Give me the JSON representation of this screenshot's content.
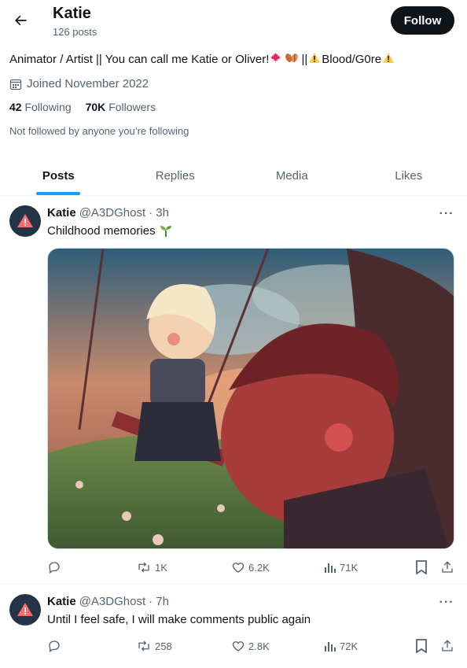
{
  "profile": {
    "name": "Katie",
    "posts_count": "126 posts",
    "follow_label": "Follow",
    "bio_a": "Animator / Artist || You can call me Katie or Oliver!",
    "bio_b": " || ",
    "bio_c": "Blood/G0re",
    "joined": "Joined November 2022",
    "following_count": "42",
    "following_label": "Following",
    "followers_count": "70K",
    "followers_label": "Followers",
    "not_followed": "Not followed by anyone you’re following"
  },
  "tabs": [
    "Posts",
    "Replies",
    "Media",
    "Likes"
  ],
  "posts": [
    {
      "name": "Katie",
      "handle": "@A3DGhost",
      "time": "· 3h",
      "text": "Childhood memories",
      "replies": "",
      "reposts": "1K",
      "likes": "6.2K",
      "views": "71K"
    },
    {
      "name": "Katie",
      "handle": "@A3DGhost",
      "time": "· 7h",
      "text": "Until I feel safe, I will make comments public again",
      "replies": "",
      "reposts": "258",
      "likes": "2.8K",
      "views": "72K"
    }
  ],
  "colors": {
    "accent": "#1d9bf0",
    "text": "#0f1419",
    "muted": "#536471"
  }
}
